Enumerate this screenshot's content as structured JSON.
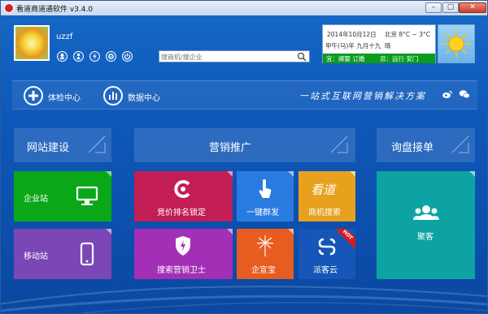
{
  "window": {
    "title": "看道商道通软件  v3.4.0",
    "minimize": "–",
    "maximize": "▢",
    "close": "✕"
  },
  "user": {
    "name": "uzzf",
    "icons": [
      "user-icon",
      "person-icon",
      "lightning-icon",
      "gear-icon",
      "power-icon"
    ]
  },
  "search": {
    "placeholder": "搜商机/搜企业",
    "value": ""
  },
  "weather": {
    "date": "2014年10月12日",
    "lunar": "甲午(马)年 九月十九",
    "city_temp": "北京   8°C ~ 3°C",
    "condition": "晴",
    "suitable": "宜：嫁娶 订婚",
    "avoid": "忌：远行 安门",
    "icon": "sun-icon"
  },
  "toolbar": {
    "checkup": "体检中心",
    "data_center": "数据中心",
    "slogan": "一站式互联网营销解决方案",
    "social": [
      "weibo-icon",
      "wechat-icon"
    ]
  },
  "sections": {
    "website": "网站建设",
    "marketing": "营销推广",
    "inquiry": "询盘接单"
  },
  "tiles": {
    "enterprise_site": "企业站",
    "mobile_site": "移动站",
    "bid_rank": "竞价排名锁定",
    "one_click": "一键群发",
    "opportunity": "商机搜索",
    "kandao_logo": "看道",
    "search_guard": "搜索营销卫士",
    "qixuanbao": "企宣宝",
    "paikeyun": "派客云",
    "hot_badge": "HOT",
    "juke": "聚客"
  },
  "colors": {
    "enterprise": "#0aa818",
    "mobile": "#7b46b6",
    "bid": "#c21d54",
    "one_click": "#2a7be0",
    "opportunity": "#e7a11d",
    "guard": "#a22fb6",
    "qixuanbao": "#e75c1f",
    "paike": "#1556b8",
    "juke": "#0da3a3"
  }
}
